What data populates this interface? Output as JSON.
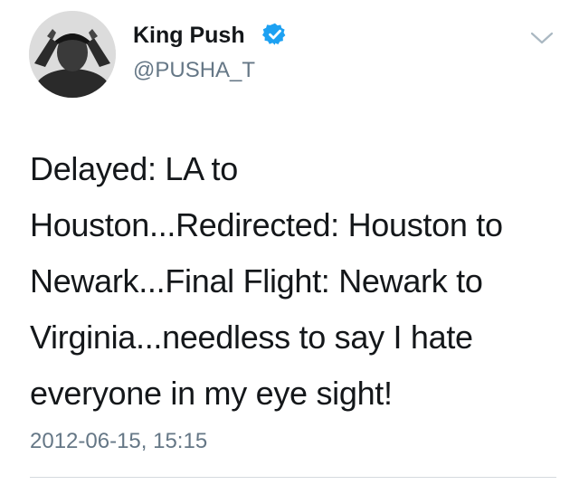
{
  "tweet": {
    "author": {
      "display_name": "King Push",
      "handle": "@PUSHA_T",
      "verified": true,
      "avatar_icon": "profile-photo"
    },
    "text": "Delayed: LA to\nHouston...Redirected: Houston to\nNewark...Final Flight: Newark to\nVirginia...needless to say I hate\neveryone in my eye sight!",
    "timestamp": "2012-06-15, 15:15",
    "menu_icon": "chevron-down-icon"
  },
  "colors": {
    "verified_badge": "#1da1f2",
    "secondary_text": "#657786",
    "primary_text": "#14171a",
    "divider": "#d5dade"
  }
}
